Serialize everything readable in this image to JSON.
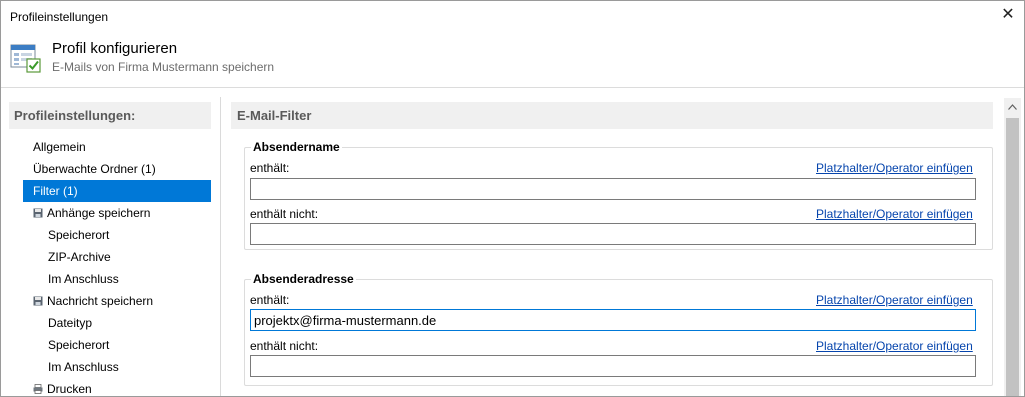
{
  "window": {
    "title": "Profileinstellungen"
  },
  "header": {
    "title": "Profil konfigurieren",
    "subtitle": "E-Mails von Firma Mustermann speichern"
  },
  "sidebar": {
    "heading": "Profileinstellungen:",
    "items": [
      {
        "label": "Allgemein",
        "level": 0,
        "selected": false,
        "icon": ""
      },
      {
        "label": "Überwachte Ordner (1)",
        "level": 0,
        "selected": false,
        "icon": ""
      },
      {
        "label": "Filter (1)",
        "level": 0,
        "selected": true,
        "icon": ""
      },
      {
        "label": "Anhänge speichern",
        "level": 0,
        "selected": false,
        "icon": "floppy-disk-icon"
      },
      {
        "label": "Speicherort",
        "level": 1,
        "selected": false,
        "icon": ""
      },
      {
        "label": "ZIP-Archive",
        "level": 1,
        "selected": false,
        "icon": ""
      },
      {
        "label": "Im Anschluss",
        "level": 1,
        "selected": false,
        "icon": ""
      },
      {
        "label": "Nachricht speichern",
        "level": 0,
        "selected": false,
        "icon": "floppy-disk-icon"
      },
      {
        "label": "Dateityp",
        "level": 1,
        "selected": false,
        "icon": ""
      },
      {
        "label": "Speicherort",
        "level": 1,
        "selected": false,
        "icon": ""
      },
      {
        "label": "Im Anschluss",
        "level": 1,
        "selected": false,
        "icon": ""
      },
      {
        "label": "Drucken",
        "level": 0,
        "selected": false,
        "icon": "printer-icon"
      }
    ]
  },
  "main": {
    "heading": "E-Mail-Filter",
    "groups": [
      {
        "label": "Absendername",
        "fields": [
          {
            "label": "enthält:",
            "link": "Platzhalter/Operator einfügen",
            "value": ""
          },
          {
            "label": "enthält nicht:",
            "link": "Platzhalter/Operator einfügen",
            "value": ""
          }
        ]
      },
      {
        "label": "Absenderadresse",
        "fields": [
          {
            "label": "enthält:",
            "link": "Platzhalter/Operator einfügen",
            "value": "projektx@firma-mustermann.de"
          },
          {
            "label": "enthält nicht:",
            "link": "Platzhalter/Operator einfügen",
            "value": ""
          }
        ]
      }
    ]
  },
  "colors": {
    "selection": "#0078d7",
    "link": "#0645ad",
    "section_bg": "#f0f0f0"
  }
}
